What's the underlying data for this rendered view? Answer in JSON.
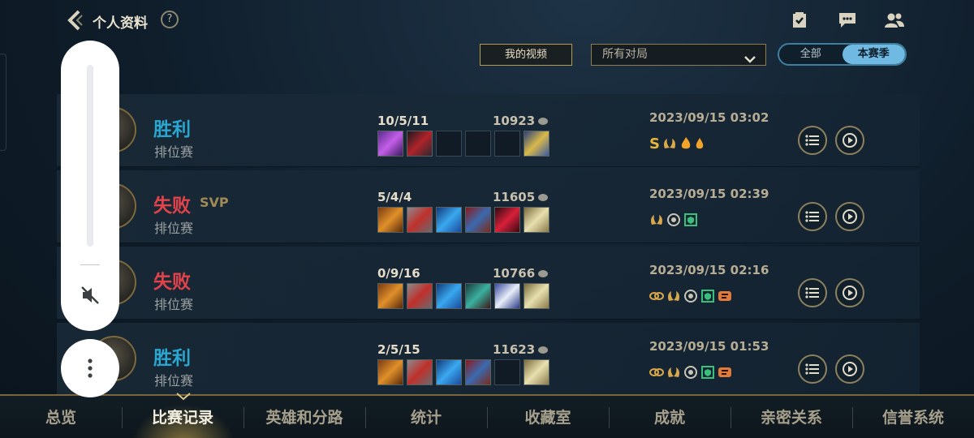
{
  "header": {
    "title": "个人资料",
    "help": "?",
    "icons": [
      "task-check-icon",
      "chat-icon",
      "friends-icon"
    ]
  },
  "filters": {
    "my_video": "我的视频",
    "match_type": "所有对局",
    "season_tabs": [
      "全部",
      "本赛季"
    ],
    "season_active": "本赛季"
  },
  "colors": {
    "accent_gold": "#b59a54",
    "win": "#2aa7d1",
    "lose": "#e2434a",
    "toggle_active": "#6fb9e3"
  },
  "matches": [
    {
      "result": "胜利",
      "result_type": "win",
      "svp": "",
      "mode": "排位赛",
      "kda": "10/5/11",
      "gold": "10923",
      "items": [
        "purple",
        "red-black",
        "empty",
        "empty",
        "empty",
        "blue-gold"
      ],
      "datetime": "2023/09/15 03:02",
      "badges": [
        "S",
        "laurel",
        "flame",
        "drop"
      ]
    },
    {
      "result": "失败",
      "result_type": "lose",
      "svp": "SVP",
      "mode": "排位赛",
      "kda": "5/4/4",
      "gold": "11605",
      "items": [
        "orange",
        "silver-red",
        "blue",
        "red-blue",
        "red-gem",
        "gold-white"
      ],
      "datetime": "2023/09/15 02:39",
      "badges": [
        "laurel",
        "swirl",
        "shield-green"
      ]
    },
    {
      "result": "失败",
      "result_type": "lose",
      "svp": "",
      "mode": "排位赛",
      "kda": "0/9/16",
      "gold": "10766",
      "items": [
        "orange",
        "silver-red",
        "blue",
        "teal-dark",
        "white-blue",
        "gold-white"
      ],
      "datetime": "2023/09/15 02:16",
      "badges": [
        "gold-chain",
        "laurel",
        "swirl",
        "shield-green",
        "orange-tag"
      ]
    },
    {
      "result": "胜利",
      "result_type": "win",
      "svp": "",
      "mode": "排位赛",
      "kda": "2/5/15",
      "gold": "11623",
      "items": [
        "orange",
        "silver-red",
        "blue",
        "red-blue",
        "empty",
        "gold-white"
      ],
      "datetime": "2023/09/15 01:53",
      "badges": [
        "gold-chain",
        "laurel",
        "swirl",
        "shield-green",
        "orange-tag"
      ]
    }
  ],
  "bottom_nav": {
    "items": [
      "总览",
      "比赛记录",
      "英雄和分路",
      "统计",
      "收藏室",
      "成就",
      "亲密关系",
      "信誉系统"
    ],
    "active_index": 1
  }
}
